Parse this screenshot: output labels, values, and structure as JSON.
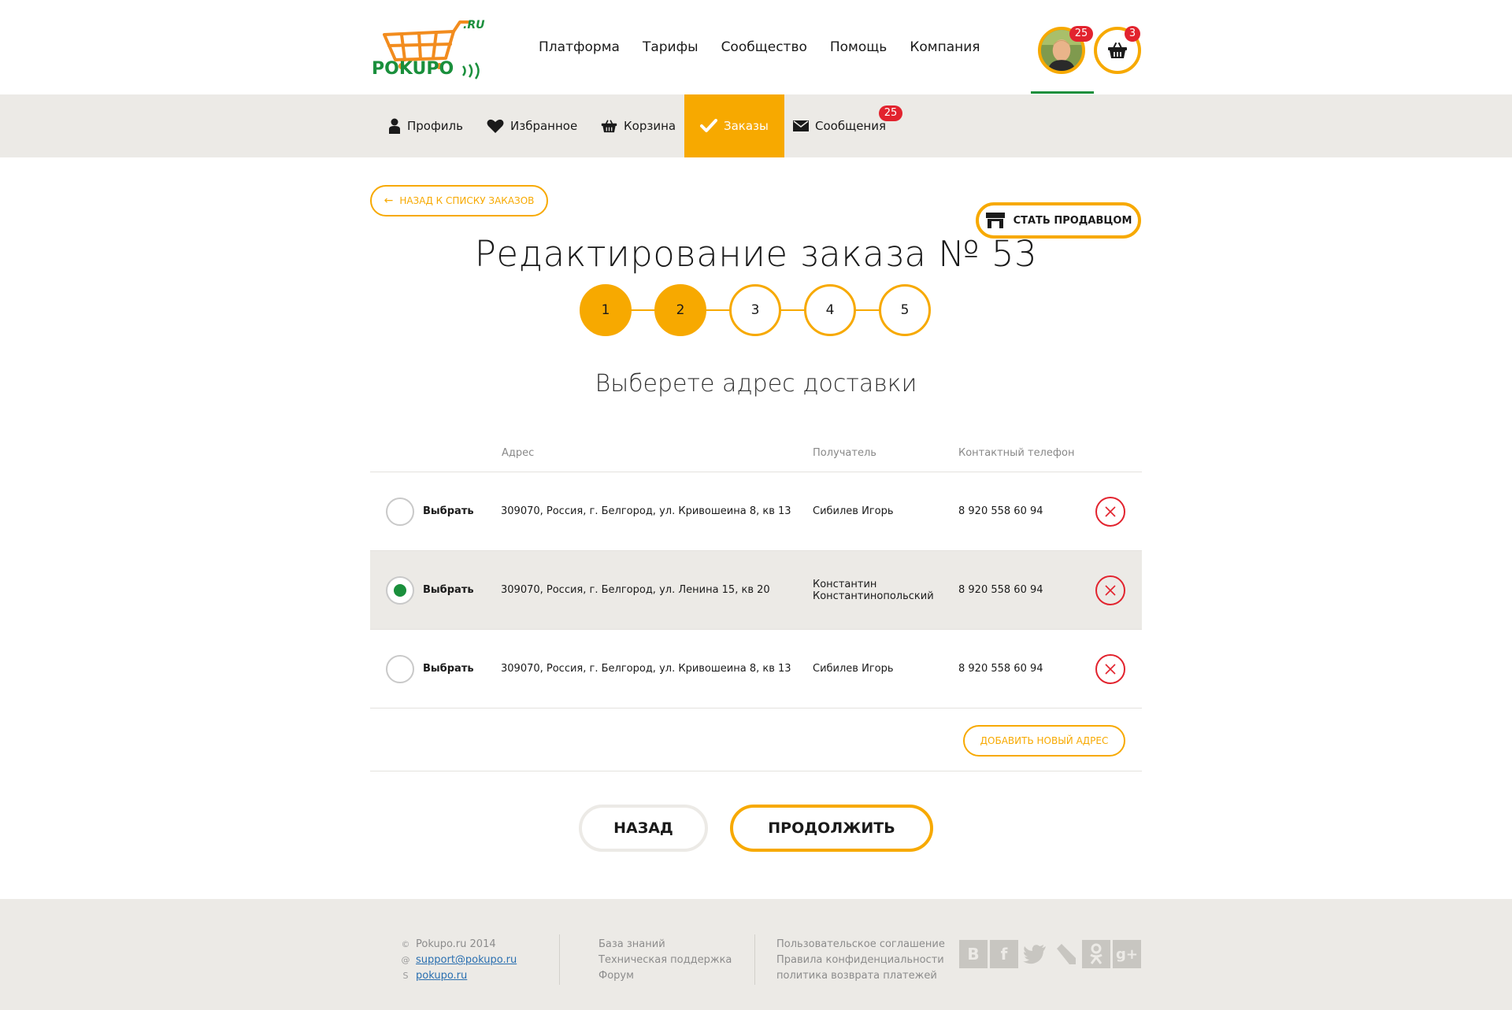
{
  "header": {
    "logo_text": "POKUPO",
    "logo_suffix": ".RU",
    "nav": [
      "Платформа",
      "Тарифы",
      "Сообщество",
      "Помощь",
      "Компания"
    ],
    "avatar_badge": "25",
    "cart_badge": "3"
  },
  "subnav": {
    "items": [
      {
        "label": "Профиль",
        "icon": "user-icon"
      },
      {
        "label": "Избранное",
        "icon": "heart-icon"
      },
      {
        "label": "Корзина",
        "icon": "basket-icon"
      },
      {
        "label": "Заказы",
        "icon": "check-icon"
      },
      {
        "label": "Сообщения",
        "icon": "envelope-icon"
      }
    ],
    "active": "Заказы",
    "messages_badge": "25",
    "seller_button": "СТАТЬ ПРОДАВЦОМ"
  },
  "main": {
    "back_link": "НАЗАД К СПИСКУ ЗАКАЗОВ",
    "title": "Редактирование заказа № 53",
    "steps": [
      "1",
      "2",
      "3",
      "4",
      "5"
    ],
    "steps_completed": 2,
    "subtitle": "Выберете адрес доставки",
    "columns": {
      "address": "Адрес",
      "recipient": "Получатель",
      "phone": "Контактный телефон"
    },
    "rows": [
      {
        "choose": "Выбрать",
        "address": "309070, Россия, г. Белгород, ул. Кривошеина 8, кв 13",
        "recipient": "Сибилев Игорь",
        "phone": "8 920 558 60 94",
        "selected": false
      },
      {
        "choose": "Выбрать",
        "address": "309070, Россия, г. Белгород, ул. Ленина 15, кв 20",
        "recipient": "Константин Константинопольский",
        "phone": "8 920 558 60 94",
        "selected": true
      },
      {
        "choose": "Выбрать",
        "address": "309070, Россия, г. Белгород, ул. Кривошеина 8, кв 13",
        "recipient": "Сибилев Игорь",
        "phone": "8 920 558 60 94",
        "selected": false
      }
    ],
    "add_address": "ДОБАВИТЬ НОВЫЙ АДРЕС",
    "btn_back": "НАЗАД",
    "btn_next": "ПРОДОЛЖИТЬ"
  },
  "footer": {
    "copyright": "Pokupo.ru 2014",
    "email": "support@pokupo.ru",
    "skype": "pokupo.ru",
    "links_1": [
      "База знаний",
      "Техническая поддержка",
      "Форум"
    ],
    "links_2": [
      "Пользовательское соглашение",
      "Правила конфиденциальности",
      "политика возврата платежей"
    ],
    "social": [
      "vk-icon",
      "facebook-icon",
      "twitter-icon",
      "livejournal-icon",
      "odnoklassniki-icon",
      "google-plus-icon"
    ]
  },
  "colors": {
    "accent": "#f7a900",
    "green": "#1a8f3c",
    "danger": "#e2232e",
    "band": "#eceae6"
  }
}
